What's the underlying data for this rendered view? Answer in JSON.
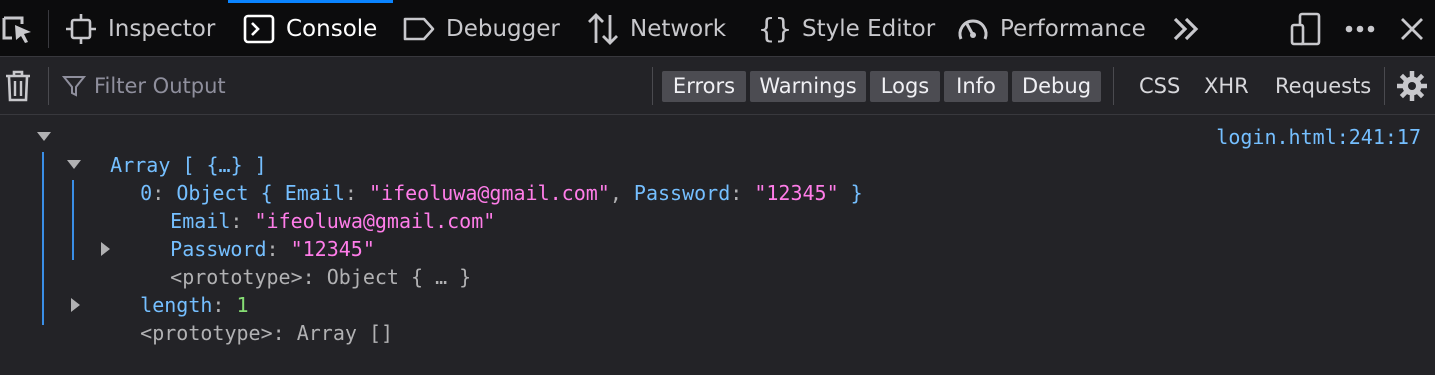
{
  "toolbar": {
    "tabs": [
      {
        "label": "Inspector",
        "icon": "inspector-icon"
      },
      {
        "label": "Console",
        "icon": "console-icon"
      },
      {
        "label": "Debugger",
        "icon": "debugger-icon"
      },
      {
        "label": "Network",
        "icon": "network-icon"
      },
      {
        "label": "Style Editor",
        "icon": "style-editor-icon"
      },
      {
        "label": "Performance",
        "icon": "performance-icon"
      }
    ],
    "selected_tab": "Console",
    "accent_color": "#0a84ff"
  },
  "filterbar": {
    "placeholder": "Filter Output",
    "levels": [
      "Errors",
      "Warnings",
      "Logs",
      "Info",
      "Debug"
    ],
    "types": [
      "CSS",
      "XHR",
      "Requests"
    ]
  },
  "console": {
    "source": "login.html:241:17",
    "array_label": "Array",
    "array_summary": "[ {…} ]",
    "item_index": "0",
    "item_class": "Object",
    "email_key": "Email",
    "email_value": "\"ifeoluwa@gmail.com\"",
    "password_key": "Password",
    "password_value": "\"12345\"",
    "proto_key": "<prototype>",
    "proto_object": "Object { … }",
    "length_key": "length",
    "length_value": "1",
    "proto_array": "Array []"
  }
}
